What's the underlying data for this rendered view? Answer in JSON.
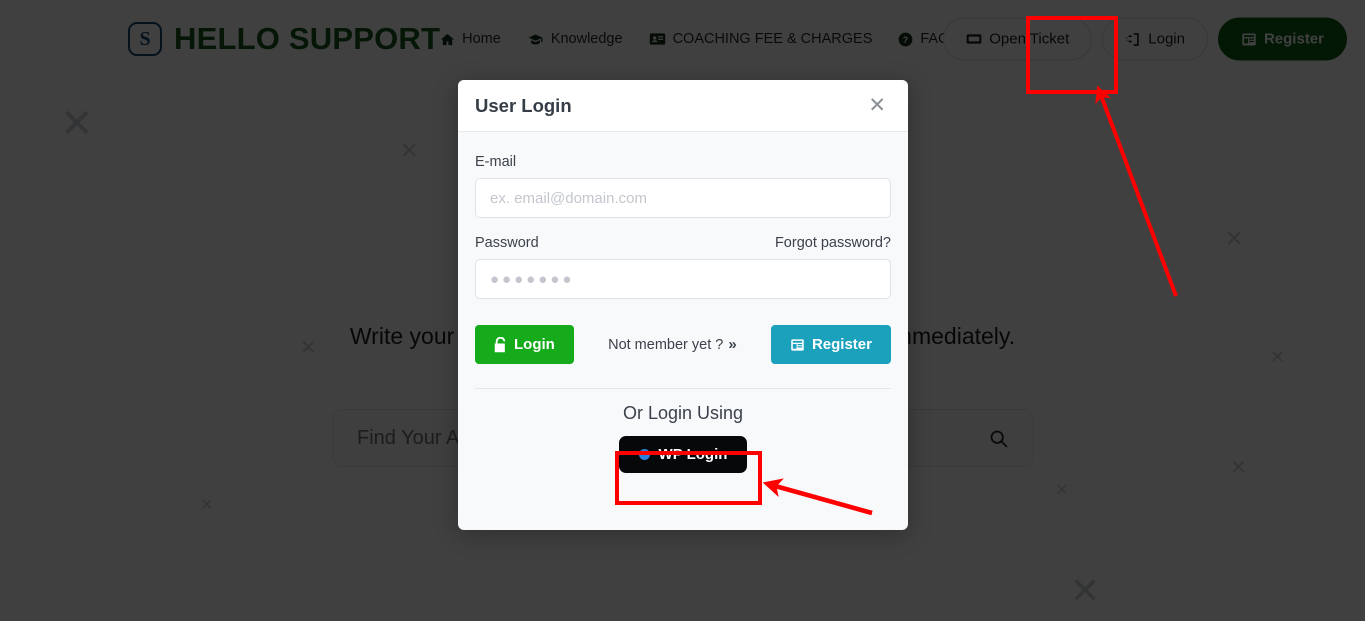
{
  "navbar": {
    "brand_mark": "S",
    "brand_text": "HELLO SUPPORT",
    "links": [
      {
        "label": "Home",
        "icon": "home-icon"
      },
      {
        "label": "Knowledge",
        "icon": "graduation-cap-icon"
      },
      {
        "label": "COACHING FEE & CHARGES",
        "icon": "id-card-icon"
      },
      {
        "label": "FAQ",
        "icon": "question-circle-icon"
      }
    ],
    "actions": [
      {
        "label": "Open Ticket",
        "icon": "ticket-icon",
        "style": "ghost"
      },
      {
        "label": "Login",
        "icon": "sign-in-icon",
        "style": "ghost"
      },
      {
        "label": "Register",
        "icon": "form-icon",
        "style": "solid"
      }
    ]
  },
  "hero": {
    "headline": "Write your question here and we will get back to you immediately.",
    "search_placeholder": "Find Your Answers",
    "search_icon": "search-icon"
  },
  "modal": {
    "title": "User Login",
    "close_icon": "close-icon",
    "email_label": "E-mail",
    "email_placeholder": "ex. email@domain.com",
    "email_value": "",
    "password_label": "Password",
    "forgot_password_label": "Forgot password?",
    "password_placeholder": "●●●●●●●",
    "password_value": "",
    "login_button": "Login",
    "login_icon": "unlock-icon",
    "not_member_text": "Not member yet ?",
    "not_member_chevron": "»",
    "register_button": "Register",
    "register_icon": "form-icon",
    "or_login_using": "Or Login Using",
    "wp_login_button": "WP Login",
    "wp_login_icon": "wordpress-dot-icon"
  },
  "annotations": {
    "color": "#fe0000",
    "highlight_login_nav": "Login",
    "highlight_wp_login": "WP Login"
  },
  "colors": {
    "brand_green": "#15571f",
    "register_green": "#0f5c14",
    "login_green": "#15ab1a",
    "register_teal": "#1ca1bd",
    "wp_black": "#07080a",
    "wp_dot_blue": "#2a7fe0",
    "annotation_red": "#fe0000",
    "overlay": "rgba(0,0,0,0.75)"
  }
}
